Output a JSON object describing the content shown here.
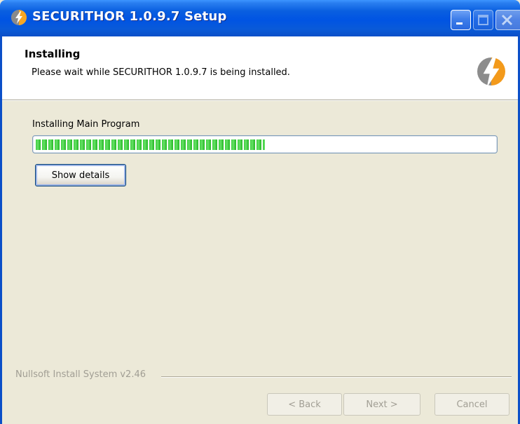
{
  "window": {
    "title": "SECURITHOR 1.0.9.7 Setup",
    "title_icon": "nsis-bolt-icon",
    "controls": [
      "minimize",
      "maximize",
      "close"
    ]
  },
  "header": {
    "title": "Installing",
    "subtitle": "Please wait while SECURITHOR 1.0.9.7 is being installed.",
    "icon": "nsis-bolt-icon"
  },
  "progress": {
    "status_text": "Installing Main Program",
    "percent": 50,
    "color": "#3fcf3f"
  },
  "buttons": {
    "show_details": "Show details",
    "back": "< Back",
    "next": "Next >",
    "cancel": "Cancel"
  },
  "footer": {
    "branding": "Nullsoft Install System v2.46"
  },
  "colors": {
    "titlebar": "#0054e3",
    "dialog_bg": "#ece9d8",
    "disabled_text": "#a19e94"
  }
}
